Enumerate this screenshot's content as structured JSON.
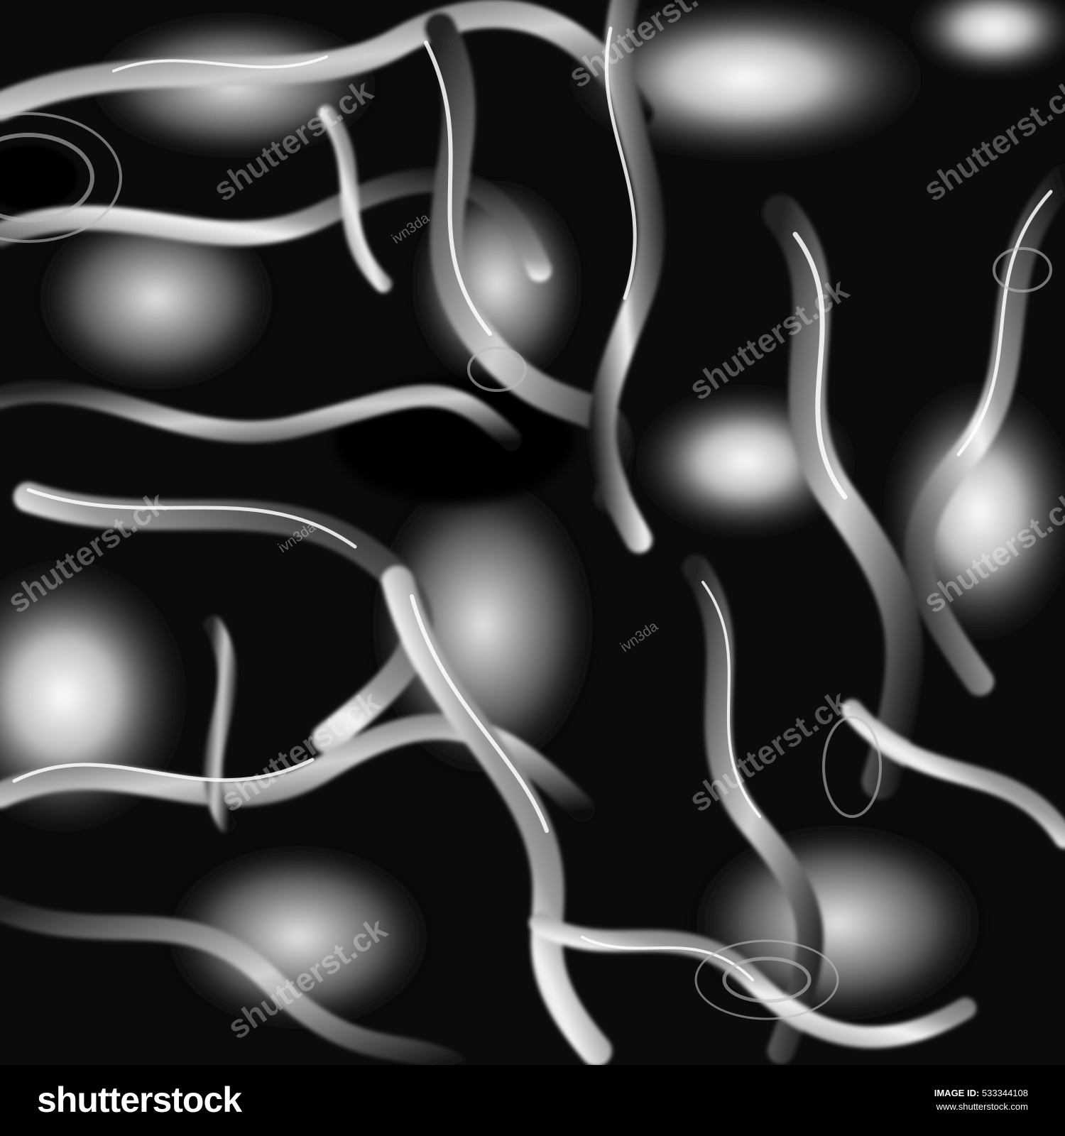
{
  "watermark": {
    "brand": "shutterstock",
    "brand_partial": "shutterst.ck",
    "contributor": "ivn3da"
  },
  "footer": {
    "logo": "shutterstock",
    "image_id_label": "IMAGE ID:",
    "image_id_value": "533344108",
    "site": "www.shutterstock.com"
  },
  "colors": {
    "background": "#000000",
    "highlight": "#ffffff",
    "metal_mid": "#8a8a8a"
  }
}
